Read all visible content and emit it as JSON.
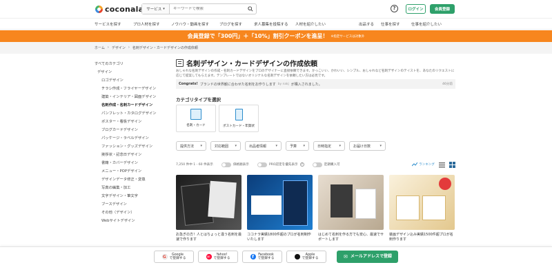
{
  "header": {
    "logo": "coconala",
    "search_service_label": "サービス",
    "search_placeholder": "キーワードで検索",
    "login_label": "ログイン",
    "register_label": "会員登録"
  },
  "category_nav": [
    "サービスを探す",
    "プロ人材を探す",
    "ノウハウ・動画を探す",
    "ブログを探す",
    "求人募集を投稿する",
    "人材を紹介したい",
    "出品する",
    "仕事を探す",
    "仕事を紹介したい"
  ],
  "banner": {
    "text": "会員登録で「300円」＋「10%」割引クーポンを進呈！",
    "note": "※指定サービスは対象外"
  },
  "breadcrumb": [
    "ホーム",
    "デザイン",
    "名刺デザイン・カードデザインの作成依頼"
  ],
  "sidebar": {
    "items": [
      {
        "label": "すべてのカテゴリ",
        "level": 0
      },
      {
        "label": "デザイン",
        "level": 1
      },
      {
        "label": "ロゴデザイン",
        "level": 2
      },
      {
        "label": "チラシ作成・フライヤーデザイン",
        "level": 2
      },
      {
        "label": "建築・インテリア・図面デザイン",
        "level": 2
      },
      {
        "label": "名刺作成・名刺カードデザイン",
        "level": 2,
        "active": true
      },
      {
        "label": "パンフレット・カタログデザイン",
        "level": 2
      },
      {
        "label": "ポスター・看板デザイン",
        "level": 2
      },
      {
        "label": "ブログカードデザイン",
        "level": 2
      },
      {
        "label": "パッケージ・ラベルデザイン",
        "level": 2
      },
      {
        "label": "ファッション・グッズデザイン",
        "level": 2
      },
      {
        "label": "挨拶状・記念日デザイン",
        "level": 2
      },
      {
        "label": "書籍・カバーデザイン",
        "level": 2
      },
      {
        "label": "メニュー・POPデザイン",
        "level": 2
      },
      {
        "label": "デザインデータ修正・変換",
        "level": 2
      },
      {
        "label": "写真の編集・加工",
        "level": 2
      },
      {
        "label": "文字デザイン・筆文字",
        "level": 2
      },
      {
        "label": "ブースデザイン",
        "level": 2
      },
      {
        "label": "その他（デザイン）",
        "level": 2
      },
      {
        "label": "Webサイトデザイン",
        "level": 2
      }
    ]
  },
  "main": {
    "title": "名刺デザイン・カードデザインの作成依頼",
    "description": "おしゃれな名刺デザインの作成・名刺カードデザインをプロのデザイナーに直接依頼できます。かっこいい、かわいい、シンプル、おしゃれなど名刺デザインのテイストを、あなたのリクエストに応じて提案してもらえます。テンプレートではないオリジナルな名刺デザインを依頼したい方は必見です。",
    "notice": {
      "lead": "Congrats!",
      "text": "ブランドの世界観に合わせた名刺をお作りします",
      "by": "by nakj",
      "tail": "が購入されました。",
      "time": "46分前"
    },
    "category_type_label": "カテゴリタイプを選択",
    "category_types": [
      {
        "label": "名刺・カード"
      },
      {
        "label": "ポストカード・年賀状"
      }
    ],
    "filters": [
      "提供方法",
      "対応範囲",
      "出品者情報",
      "予算",
      "日時指定",
      "お届け日数"
    ],
    "result_count": "7,250 件中 1 - 60 件表示",
    "toggles": [
      "価格順表示",
      "PRO認定を優先表示",
      "定期購入可"
    ],
    "ranking_label": "ランキング",
    "cards": [
      {
        "text": "お急ぎの方！人とはちょっと違う名刺を最速で作ります",
        "colors": [
          "#1c1c1c",
          "#555555"
        ]
      },
      {
        "text": "ココナラ実績1800件超のプロが名刺制作いたします",
        "colors": [
          "#0b3d7a",
          "#1f7fd1"
        ]
      },
      {
        "text": "はじめて名刺を作る方でも安心、最速でサポートします",
        "colors": [
          "#d9cfc0",
          "#8a7a66"
        ]
      },
      {
        "text": "装画デザイン込み実績1500件超プロが名刺作ります",
        "colors": [
          "#f6e7c4",
          "#c9a96b"
        ]
      }
    ]
  },
  "social": [
    {
      "label": "Google\nで登録する",
      "icon": "G",
      "color": "#db4437"
    },
    {
      "label": "Yahoo!\nで登録する",
      "icon": "Y!",
      "color": "#ff0033"
    },
    {
      "label": "Facebook\nで登録する",
      "icon": "f",
      "color": "#1877f2"
    },
    {
      "label": "Apple\nで登録する",
      "icon": "",
      "color": "#111111"
    },
    {
      "label": "メールアドレスで登録",
      "icon": "✉",
      "color": "#2ea06a"
    }
  ]
}
